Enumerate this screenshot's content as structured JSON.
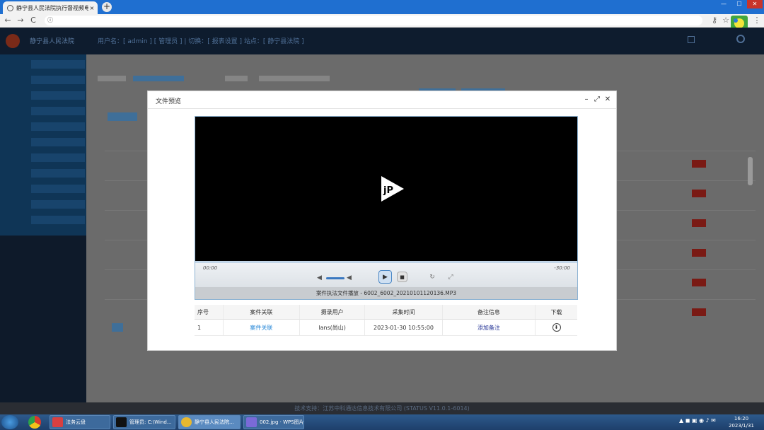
{
  "browser": {
    "tab_title": "静宁县人民法院执行督视频电子...",
    "tab_close": "×",
    "new_tab": "+",
    "win_minimize": "—",
    "win_maximize": "☐",
    "win_close": "✕",
    "back": "←",
    "forward": "→",
    "reload": "C",
    "info": "ⓘ",
    "key_icon": "⚷",
    "star": "☆",
    "menu": "⋮"
  },
  "app": {
    "court_title": "静宁县人民法院",
    "user_menu": "用户名：[ admin ] [ 管理员 ] | 切换：[ 报表设置 ] 站点：[ 静宁县法院 ]",
    "footer": "技术支持：江苏中科通达信息技术有限公司   (STATUS V11.0.1-6014)"
  },
  "modal": {
    "title": "文件预览",
    "minimize": "–",
    "maximize": "⤢",
    "close": "✕",
    "player": {
      "time_current": "00:00",
      "time_total": "-30:00",
      "filename": "案件执法文件播放 - 6002_6002_20210101120136.MP3"
    },
    "table": {
      "headers": [
        "序号",
        "案件关联",
        "摄录用户",
        "采集时间",
        "备注信息",
        "下载"
      ],
      "rows": [
        {
          "index": "1",
          "case_link": "案件关联",
          "user": "lans(尚山)",
          "time": "2023-01-30 10:55:00",
          "note_link": "添加备注"
        }
      ]
    }
  },
  "taskbar": {
    "items": [
      {
        "label": "法务云盘",
        "color": "#d84040"
      },
      {
        "label": "管理员: C:\\Wind...",
        "color": "#111111"
      },
      {
        "label": "静宁县人民法院...",
        "color": "#e8b830"
      },
      {
        "label": "002.jpg · WPS图片",
        "color": "#7a6ad8"
      }
    ],
    "time": "16:20",
    "date": "2023/1/31"
  }
}
